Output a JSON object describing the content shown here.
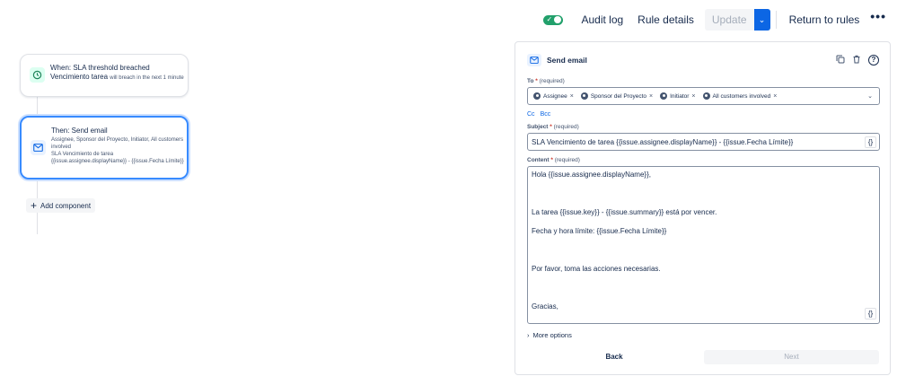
{
  "topbar": {
    "toggle_on": true,
    "audit_log": "Audit log",
    "rule_details": "Rule details",
    "update": "Update",
    "return_to_rules": "Return to rules",
    "more": "•••"
  },
  "trigger": {
    "title": "When: SLA threshold breached",
    "sla_name": "Vencimiento tarea",
    "detail": "will breach in the next 1 minute",
    "icon": "clock-icon"
  },
  "action": {
    "title": "Then: Send email",
    "recipients": "Assignee, Sponsor del Proyecto, Initiator, All customers involved",
    "subject_preview": "SLA Vencimiento de tarea {{issue.assignee.displayName}} - {{issue.Fecha Límite}}",
    "icon": "mail-icon"
  },
  "add_component": "Add component",
  "panel": {
    "title": "Send email",
    "to_label": "To",
    "required": "(required)",
    "recipients": [
      {
        "label": "Assignee",
        "icon": "user-icon"
      },
      {
        "label": "Sponsor del Proyecto",
        "icon": "user-icon"
      },
      {
        "label": "Initiator",
        "icon": "person-icon"
      },
      {
        "label": "All customers involved",
        "icon": "users-icon"
      }
    ],
    "cc": "Cc",
    "bcc": "Bcc",
    "subject_label": "Subject",
    "subject_value": "SLA Vencimiento de tarea {{issue.assignee.displayName}} - {{issue.Fecha Límite}}",
    "content_label": "Content",
    "content_lines": [
      "Hola {{issue.assignee.displayName}},",
      "La tarea {{issue.key}} - {{issue.summary}} está por vencer.",
      "Fecha y hora límite: {{issue.Fecha Límite}}",
      "Por favor, toma las acciones necesarias.",
      "Gracias,"
    ],
    "more_options": "More options",
    "back": "Back",
    "next": "Next",
    "smart_values_glyph": "{}"
  },
  "colors": {
    "accent": "#0c66e4",
    "toggle": "#22a06b",
    "selected_border": "#388bff"
  }
}
